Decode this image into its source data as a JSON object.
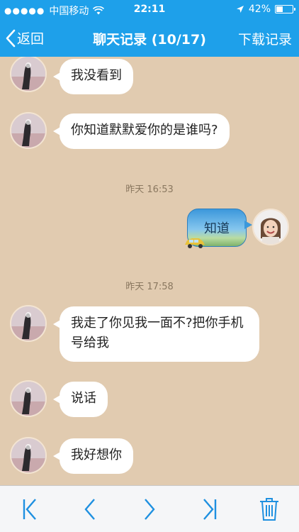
{
  "status_bar": {
    "carrier": "中国移动",
    "time": "22:11",
    "battery": "42%",
    "battery_level": 0.42
  },
  "nav": {
    "back_label": "返回",
    "title": "聊天记录 (10/17)",
    "download_label": "下载记录"
  },
  "messages": {
    "m1": {
      "text": "我没看到"
    },
    "m2": {
      "text": "你知道默默爱你的是谁吗?"
    },
    "t1": "昨天 16:53",
    "m3": {
      "text": "知道"
    },
    "t2": "昨天 17:58",
    "m4": {
      "text": "我走了你见我一面不?把你手机号给我"
    },
    "m5": {
      "text": "说话"
    },
    "m6": {
      "text": "我好想你"
    }
  },
  "toolbar": {
    "icons": [
      "first-page-icon",
      "prev-page-icon",
      "next-page-icon",
      "last-page-icon",
      "trash-icon"
    ]
  },
  "colors": {
    "accent": "#1ea0ea",
    "chat_background": "#e1cbb0",
    "bubble": "#ffffff",
    "timestamp": "#8a7860"
  }
}
